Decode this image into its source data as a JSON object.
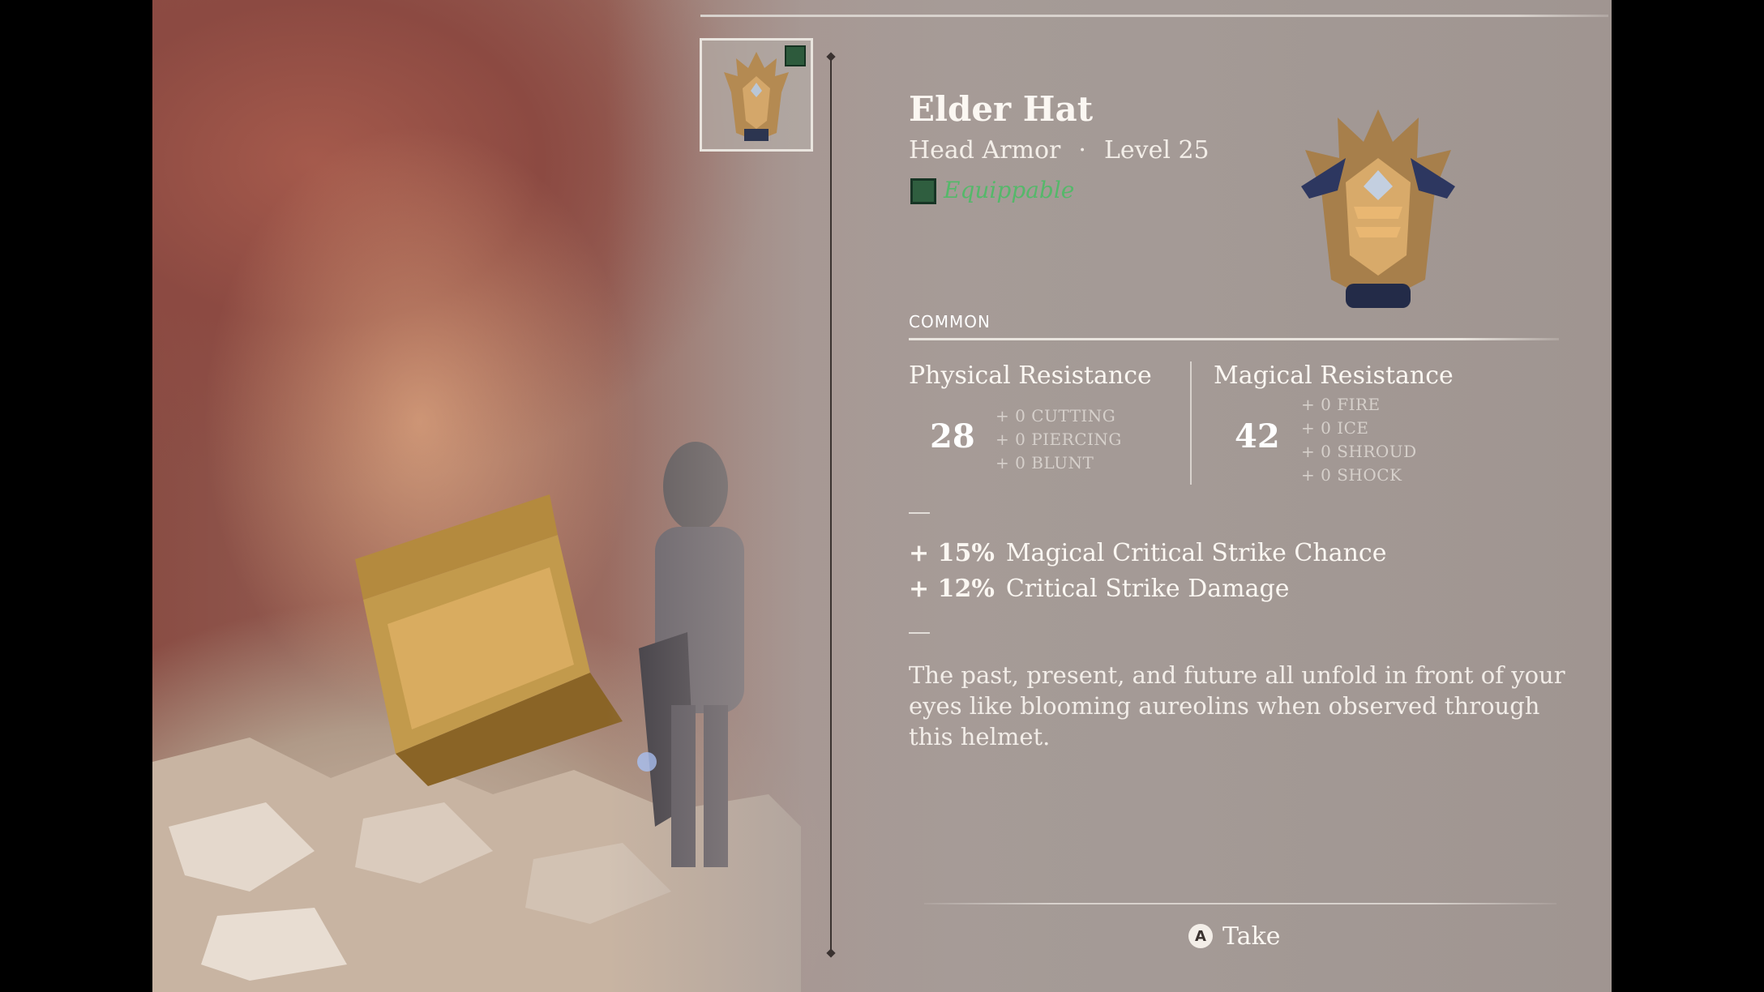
{
  "item": {
    "name": "Elder Hat",
    "type": "Head Armor",
    "separator": "·",
    "level": "Level 25",
    "status": "Equippable",
    "rarity": "COMMON"
  },
  "physical": {
    "label": "Physical Resistance",
    "value": "28",
    "subs": [
      "+ 0 CUTTING",
      "+ 0 PIERCING",
      "+ 0 BLUNT"
    ]
  },
  "magical": {
    "label": "Magical Resistance",
    "value": "42",
    "subs": [
      "+ 0 FIRE",
      "+ 0 ICE",
      "+ 0 SHROUD",
      "+ 0 SHOCK"
    ]
  },
  "bonuses": [
    {
      "pct": "+ 15%",
      "label": "Magical Critical Strike Chance"
    },
    {
      "pct": "+ 12%",
      "label": "Critical Strike Damage"
    }
  ],
  "description": "The past, present, and future all unfold in front of your eyes like blooming aureolins when observed through this helmet.",
  "action": {
    "button": "A",
    "label": "Take"
  },
  "icons": {
    "thumbnail": "helmet-icon",
    "equip": "equippable-icon",
    "preview": "helmet-preview-icon",
    "button": "a-button-icon"
  },
  "colors": {
    "equippable": "#55b86a",
    "text": "#fbf7f2"
  }
}
